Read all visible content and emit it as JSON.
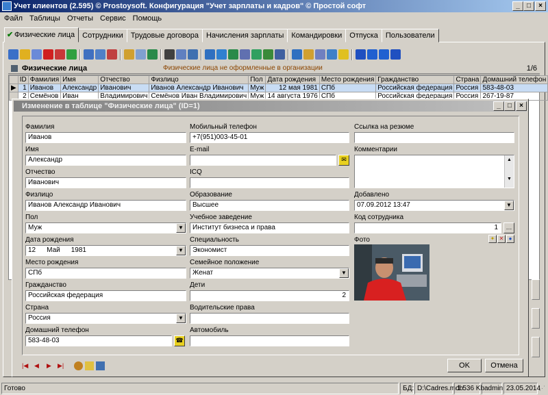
{
  "window": {
    "title": "Учет клиентов (2.595) © Prostoysoft. Конфигурация \"Учет зарплаты и кадров\" © Простой софт"
  },
  "menu": [
    "Файл",
    "Таблицы",
    "Отчеты",
    "Сервис",
    "Помощь"
  ],
  "tabs": [
    "Физические лица",
    "Сотрудники",
    "Трудовые договора",
    "Начисления зарплаты",
    "Командировки",
    "Отпуска",
    "Пользователи"
  ],
  "grid": {
    "title": "Физические лица",
    "note": "Физические лица не оформленные в организации",
    "count": "1/6",
    "columns": [
      "ID",
      "Фамилия",
      "Имя",
      "Отчество",
      "Физлицо",
      "Пол",
      "Дата рождения",
      "Место рождения",
      "Гражданство",
      "Страна",
      "Домашний телефон"
    ],
    "rows": [
      [
        "1",
        "Иванов",
        "Александр",
        "Иванович",
        "Иванов Александр  Иванович",
        "Муж",
        "12 мая 1981",
        "СПб",
        "Российская федерация",
        "Россия",
        "583-48-03"
      ],
      [
        "2",
        "Семёнов",
        "Иван",
        "Владимирович",
        "Семёнов Иван Владимирович",
        "Муж",
        "14 августа 1976",
        "СПб",
        "Российская федерация",
        "Россия",
        "267-19-87"
      ]
    ]
  },
  "dialog": {
    "title": "Изменение в таблице \"Физические лица\" (ID=1)",
    "col1": {
      "last_name_label": "Фамилия",
      "last_name": "Иванов",
      "first_name_label": "Имя",
      "first_name": "Александр",
      "patronymic_label": "Отчество",
      "patronymic": "Иванович",
      "person_label": "Физлицо",
      "person": "Иванов Александр  Иванович",
      "gender_label": "Пол",
      "gender": "Муж",
      "birth_label": "Дата рождения",
      "birth_day": "12",
      "birth_month": "Май",
      "birth_year": "1981",
      "birthplace_label": "Место рождения",
      "birthplace": "СПб",
      "citizenship_label": "Гражданство",
      "citizenship": "Российская федерация",
      "country_label": "Страна",
      "country": "Россия",
      "home_phone_label": "Домашний телефон",
      "home_phone": "583-48-03"
    },
    "col2": {
      "mobile_label": "Мобильный телефон",
      "mobile": "+7(951)003-45-01",
      "email_label": "E-mail",
      "email": "",
      "icq_label": "ICQ",
      "icq": "",
      "education_label": "Образование",
      "education": "Высшее",
      "school_label": "Учебное заведение",
      "school": "Институт бизнеса и права",
      "specialty_label": "Специальность",
      "specialty": "Экономист",
      "marital_label": "Семейное положение",
      "marital": "Женат",
      "children_label": "Дети",
      "children": "2",
      "license_label": "Водительские права",
      "license": "",
      "car_label": "Автомобиль",
      "car": ""
    },
    "col3": {
      "resume_label": "Ссылка на резюме",
      "resume": "",
      "comments_label": "Комментарии",
      "comments": "",
      "added_label": "Добавлено",
      "added": "07.09.2012 13:47",
      "employee_code_label": "Код сотрудника",
      "employee_code": "1",
      "photo_label": "Фото"
    },
    "ok": "OK",
    "cancel": "Отмена"
  },
  "status": {
    "ready": "Готово",
    "db_label": "БД:",
    "db_path": "D:\\Cadres.mdb",
    "size": "1 536 Kb",
    "user": "admin",
    "date": "23.05.2014"
  }
}
